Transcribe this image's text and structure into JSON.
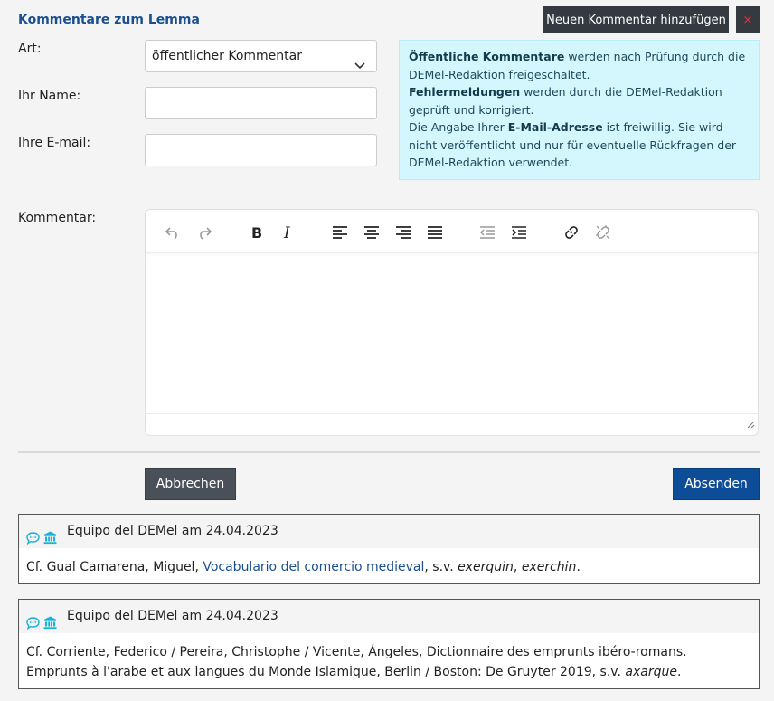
{
  "header": {
    "title": "Kommentare zum Lemma",
    "add_button": "Neuen Kommentar hinzufügen",
    "close_button": "×"
  },
  "form": {
    "art_label": "Art:",
    "art_value": "öffentlicher Kommentar",
    "name_label": "Ihr Name:",
    "name_value": "",
    "email_label": "Ihre E-mail:",
    "email_value": "",
    "comment_label": "Kommentar:",
    "cancel_button": "Abbrechen",
    "submit_button": "Absenden"
  },
  "info": {
    "line1_bold": "Öffentliche Kommentare",
    "line1_rest": " werden nach Prüfung durch die DEMel-Redaktion freigeschaltet.",
    "line2_bold": "Fehlermeldungen",
    "line2_rest": " werden durch die DEMel-Redaktion geprüft und korrigiert.",
    "line3_pre": "Die Angabe Ihrer ",
    "line3_bold": "E-Mail-Adresse",
    "line3_rest": " ist freiwillig. Sie wird nicht veröffentlicht und nur für eventuelle Rückfragen der DEMel-Redaktion verwendet."
  },
  "toolbar": {
    "icons": [
      "undo-icon",
      "redo-icon",
      "bold-icon",
      "italic-icon",
      "align-left-icon",
      "align-center-icon",
      "align-right-icon",
      "align-justify-icon",
      "outdent-icon",
      "indent-icon",
      "link-icon",
      "unlink-icon"
    ]
  },
  "comments": [
    {
      "author_line": "Equipo del DEMel am 24.04.2023",
      "text_pre": "Cf. Gual Camarena, Miguel, ",
      "link_text": "Vocabulario del comercio medieval",
      "text_mid": ", s.v. ",
      "italic1": "exerquin",
      "sep": ", ",
      "italic2": "exerchin",
      "text_end": "."
    },
    {
      "author_line": "Equipo del DEMel am 24.04.2023",
      "text_pre": "Cf. Corriente, Federico / Pereira, Christophe / Vicente, Ángeles, Dictionnaire des emprunts ibéro-romans. Emprunts à l'arabe et aux langues du Monde Islamique, Berlin / Boston: De Gruyter 2019, s.v. ",
      "italic1": "axarque",
      "text_end": "."
    }
  ],
  "colors": {
    "accent": "#1b4f8f",
    "info_bg": "#d4f6fd",
    "icon_cyan": "#17b3d8",
    "dark_button": "#343a40",
    "submit_bg": "#0d4d97"
  }
}
